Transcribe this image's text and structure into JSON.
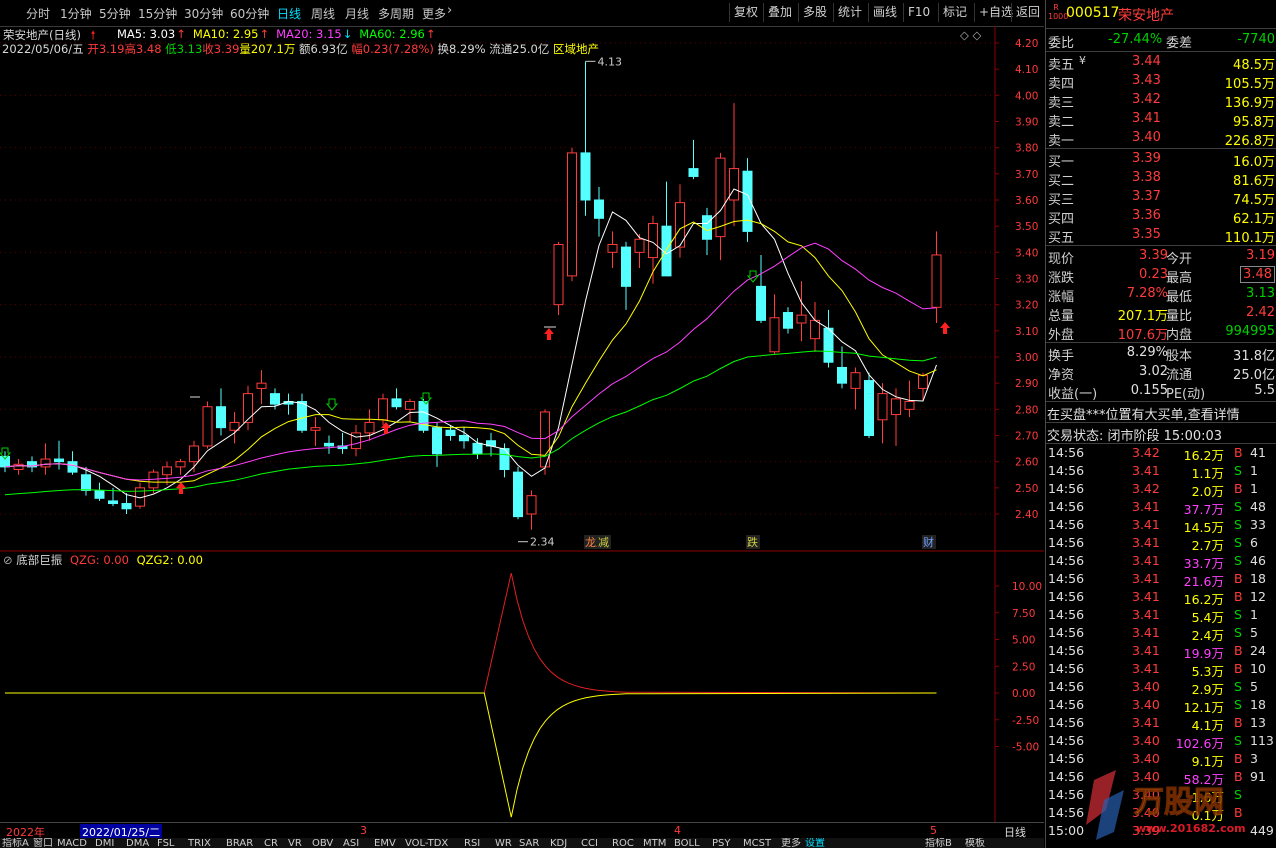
{
  "toolbar": {
    "left_items": [
      "分时",
      "1分钟",
      "5分钟",
      "15分钟",
      "30分钟",
      "60分钟",
      "日线",
      "周线",
      "月线",
      "多周期",
      "更多"
    ],
    "active": "日线",
    "right_items": [
      "复权",
      "叠加",
      "多股",
      "统计",
      "画线",
      "F10",
      "标记",
      "+自选",
      "返回"
    ]
  },
  "stock": {
    "title": "荣安地产(日线)",
    "code": "000517",
    "name": "荣安地产",
    "code_prefix": "R"
  },
  "ma_legend": [
    {
      "label": "MA5: 3.03",
      "color": "#ffffff"
    },
    {
      "label": "MA10: 2.95",
      "color": "#ffff00"
    },
    {
      "label": "MA20: 3.15",
      "color": "#ff40ff"
    },
    {
      "label": "MA60: 2.96",
      "color": "#00ff00"
    }
  ],
  "quote_line": {
    "date": "2022/05/06/五",
    "open": "开3.19",
    "high": "高3.48",
    "low": "低3.13",
    "close": "收3.39",
    "vol": "量207.1万",
    "amt": "额6.93亿",
    "chg": "幅0.23(7.28%)",
    "turn": "换8.29%",
    "float": "流通25.0亿",
    "sector": "区域地产"
  },
  "price_axis": [
    "4.20",
    "4.10",
    "4.00",
    "3.90",
    "3.80",
    "3.70",
    "3.60",
    "3.50",
    "3.40",
    "3.30",
    "3.20",
    "3.10",
    "3.00",
    "2.90",
    "2.80",
    "2.70",
    "2.60",
    "2.50",
    "2.40"
  ],
  "chart_annotations": {
    "high": "4.13",
    "low": "2.34",
    "tags": [
      "龙虎",
      "减",
      "跌",
      "财"
    ]
  },
  "indicator": {
    "name": "底部巨振",
    "qzg": "QZG: 0.00",
    "qzg2": "QZG2: 0.00",
    "axis": [
      "10.00",
      "7.50",
      "5.00",
      "2.50",
      "0.00",
      "-2.50",
      "-5.00"
    ]
  },
  "date_axis": {
    "year": "2022年",
    "cursor": "2022/01/25/二",
    "m3": "3",
    "m4": "4",
    "m5": "5",
    "btn": "日线"
  },
  "indicator_tabs": [
    "指标A",
    "窗口",
    "MACD",
    "DMI",
    "DMA",
    "FSL",
    "TRIX",
    "BRAR",
    "CR",
    "VR",
    "OBV",
    "ASI",
    "EMV",
    "VOL-TDX",
    "RSI",
    "WR",
    "SAR",
    "KDJ",
    "CCI",
    "ROC",
    "MTM",
    "BOLL",
    "PSY",
    "MCST",
    "更多",
    "设置"
  ],
  "indicator_tabs_right": [
    "指标B",
    "模板"
  ],
  "order_book": {
    "weibi_label": "委比",
    "weibi": "-27.44%",
    "weicha_label": "委差",
    "weicha": "-7740",
    "sells": [
      {
        "label": "卖五",
        "mark": "¥",
        "price": "3.44",
        "vol": "48.5万"
      },
      {
        "label": "卖四",
        "price": "3.43",
        "vol": "105.5万"
      },
      {
        "label": "卖三",
        "price": "3.42",
        "vol": "136.9万"
      },
      {
        "label": "卖二",
        "price": "3.41",
        "vol": "95.8万"
      },
      {
        "label": "卖一",
        "price": "3.40",
        "vol": "226.8万"
      }
    ],
    "buys": [
      {
        "label": "买一",
        "price": "3.39",
        "vol": "16.0万"
      },
      {
        "label": "买二",
        "price": "3.38",
        "vol": "81.6万"
      },
      {
        "label": "买三",
        "price": "3.37",
        "vol": "74.5万"
      },
      {
        "label": "买四",
        "price": "3.36",
        "vol": "62.1万"
      },
      {
        "label": "买五",
        "price": "3.35",
        "vol": "110.1万"
      }
    ]
  },
  "stats": [
    {
      "l1": "现价",
      "v1": "3.39",
      "c1": "red",
      "l2": "今开",
      "v2": "3.19",
      "c2": "red"
    },
    {
      "l1": "涨跌",
      "v1": "0.23",
      "c1": "red",
      "l2": "最高",
      "v2": "3.48",
      "c2": "red"
    },
    {
      "l1": "涨幅",
      "v1": "7.28%",
      "c1": "red",
      "l2": "最低",
      "v2": "3.13",
      "c2": "green"
    },
    {
      "l1": "总量",
      "v1": "207.1万",
      "c1": "yellow",
      "l2": "量比",
      "v2": "2.42",
      "c2": "red"
    },
    {
      "l1": "外盘",
      "v1": "107.6万",
      "c1": "red",
      "l2": "内盘",
      "v2": "994995",
      "c2": "green"
    }
  ],
  "stats2": [
    {
      "l1": "换手",
      "v1": "8.29%",
      "l2": "股本",
      "v2": "31.8亿"
    },
    {
      "l1": "净资",
      "v1": "3.02",
      "l2": "流通",
      "v2": "25.0亿"
    },
    {
      "l1": "收益(一)",
      "v1": "0.155",
      "l2": "PE(动)",
      "v2": "5.5"
    }
  ],
  "notice": "在买盘***位置有大买单,查看详情",
  "trade_status": "交易状态: 闭市阶段 15:00:03",
  "trades": [
    {
      "t": "14:56",
      "p": "3.42",
      "v": "16.2万",
      "s": "B",
      "n": "41",
      "c": "yellow"
    },
    {
      "t": "14:56",
      "p": "3.41",
      "v": "1.1万",
      "s": "S",
      "n": "1",
      "c": "yellow"
    },
    {
      "t": "14:56",
      "p": "3.42",
      "v": "2.0万",
      "s": "B",
      "n": "1",
      "c": "yellow"
    },
    {
      "t": "14:56",
      "p": "3.41",
      "v": "37.7万",
      "s": "S",
      "n": "48",
      "c": "magenta"
    },
    {
      "t": "14:56",
      "p": "3.41",
      "v": "14.5万",
      "s": "S",
      "n": "33",
      "c": "yellow"
    },
    {
      "t": "14:56",
      "p": "3.41",
      "v": "2.7万",
      "s": "S",
      "n": "6",
      "c": "yellow"
    },
    {
      "t": "14:56",
      "p": "3.41",
      "v": "33.7万",
      "s": "S",
      "n": "46",
      "c": "magenta"
    },
    {
      "t": "14:56",
      "p": "3.41",
      "v": "21.6万",
      "s": "B",
      "n": "18",
      "c": "magenta"
    },
    {
      "t": "14:56",
      "p": "3.41",
      "v": "16.2万",
      "s": "B",
      "n": "12",
      "c": "yellow"
    },
    {
      "t": "14:56",
      "p": "3.41",
      "v": "5.4万",
      "s": "S",
      "n": "1",
      "c": "yellow"
    },
    {
      "t": "14:56",
      "p": "3.41",
      "v": "2.4万",
      "s": "S",
      "n": "5",
      "c": "yellow"
    },
    {
      "t": "14:56",
      "p": "3.41",
      "v": "19.9万",
      "s": "B",
      "n": "24",
      "c": "magenta"
    },
    {
      "t": "14:56",
      "p": "3.41",
      "v": "5.3万",
      "s": "B",
      "n": "10",
      "c": "yellow"
    },
    {
      "t": "14:56",
      "p": "3.40",
      "v": "2.9万",
      "s": "S",
      "n": "5",
      "c": "yellow"
    },
    {
      "t": "14:56",
      "p": "3.40",
      "v": "12.1万",
      "s": "S",
      "n": "18",
      "c": "yellow"
    },
    {
      "t": "14:56",
      "p": "3.41",
      "v": "4.1万",
      "s": "B",
      "n": "13",
      "c": "yellow"
    },
    {
      "t": "14:56",
      "p": "3.40",
      "v": "102.6万",
      "s": "S",
      "n": "113",
      "c": "magenta"
    },
    {
      "t": "14:56",
      "p": "3.40",
      "v": "9.1万",
      "s": "B",
      "n": "3",
      "c": "yellow"
    },
    {
      "t": "14:56",
      "p": "3.40",
      "v": "58.2万",
      "s": "B",
      "n": "91",
      "c": "magenta"
    },
    {
      "t": "14:56",
      "p": "3.40",
      "v": "1.6万",
      "s": "S",
      "n": "",
      "c": "yellow"
    },
    {
      "t": "14:56",
      "p": "3.40",
      "v": "0.1万",
      "s": "B",
      "n": "",
      "c": "yellow"
    },
    {
      "t": "15:00",
      "p": "3.39",
      "v": "",
      "s": "",
      "n": "449",
      "c": "yellow"
    }
  ],
  "watermark": {
    "brand": "万股网",
    "url": "www.201682.com"
  },
  "colors": {
    "up": "#ff3b3b",
    "down": "#54ffff",
    "ma5": "#ffffff",
    "ma10": "#ffff00",
    "ma20": "#ff40ff",
    "ma60": "#00ff00"
  }
}
